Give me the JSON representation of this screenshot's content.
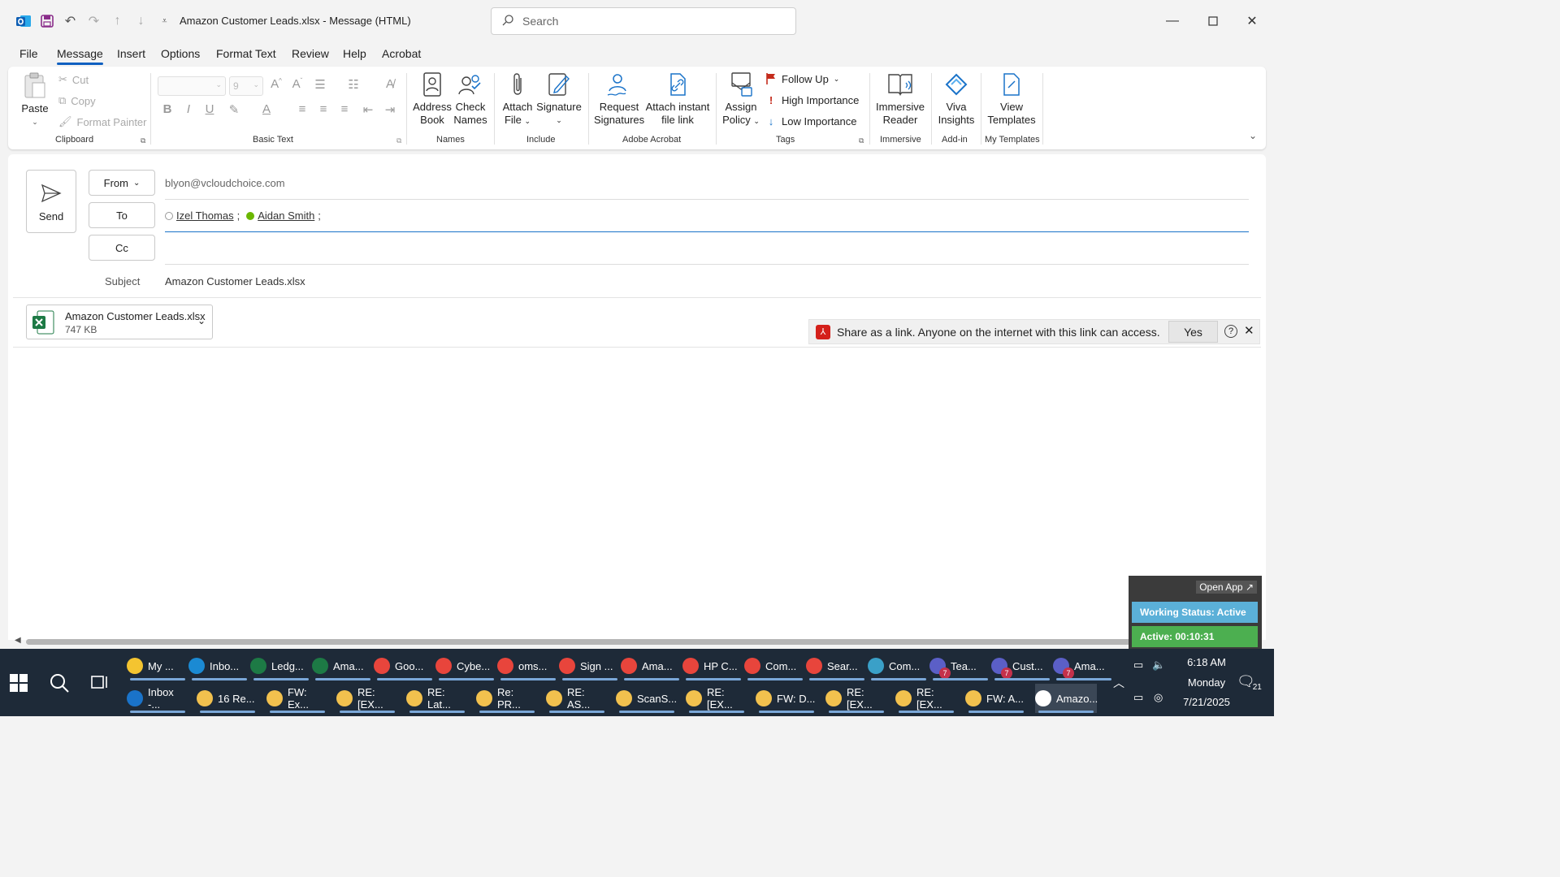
{
  "titlebar": {
    "title": "Amazon Customer Leads.xlsx  -  Message (HTML)",
    "search_placeholder": "Search"
  },
  "menu": {
    "tabs": [
      "File",
      "Message",
      "Insert",
      "Options",
      "Format Text",
      "Review",
      "Help",
      "Acrobat"
    ],
    "active": "Message"
  },
  "ribbon": {
    "clipboard": {
      "label": "Clipboard",
      "paste": "Paste",
      "cut": "Cut",
      "copy": "Copy",
      "format_painter": "Format Painter"
    },
    "basic_text": {
      "label": "Basic Text",
      "font_size": "9"
    },
    "names": {
      "label": "Names",
      "address_book": [
        "Address",
        "Book"
      ],
      "check_names": [
        "Check",
        "Names"
      ]
    },
    "include": {
      "label": "Include",
      "attach_file": [
        "Attach",
        "File"
      ],
      "signature": "Signature"
    },
    "adobe": {
      "label": "Adobe Acrobat",
      "request_signatures": [
        "Request",
        "Signatures"
      ],
      "attach_instant": [
        "Attach instant",
        "file link"
      ]
    },
    "tags": {
      "label": "Tags",
      "assign_policy": [
        "Assign",
        "Policy"
      ],
      "follow_up": "Follow Up",
      "high": "High Importance",
      "low": "Low Importance"
    },
    "immersive": {
      "label": "Immersive",
      "reader": [
        "Immersive",
        "Reader"
      ]
    },
    "addin": {
      "label": "Add-in",
      "viva": [
        "Viva",
        "Insights"
      ]
    },
    "templates": {
      "label": "My Templates",
      "view": [
        "View",
        "Templates"
      ]
    }
  },
  "compose": {
    "send": "Send",
    "from_label": "From",
    "from_value": "blyon@vcloudchoice.com",
    "to_label": "To",
    "recipients": [
      "Izel Thomas",
      "Aidan Smith"
    ],
    "cc_label": "Cc",
    "subject_label": "Subject",
    "subject_value": "Amazon Customer Leads.xlsx",
    "attachment": {
      "name": "Amazon Customer Leads.xlsx",
      "size": "747 KB"
    },
    "infobar": {
      "text": "Share as a link. Anyone on the internet with this link can access.",
      "yes": "Yes"
    }
  },
  "widget": {
    "open_app": "Open App",
    "status": "Working Status: Active",
    "active": "Active: 00:10:31"
  },
  "taskbar": {
    "row1": [
      {
        "label": "My ...",
        "icon": "folder-icon",
        "color": "#f4c430"
      },
      {
        "label": "Inbo...",
        "icon": "edge-icon",
        "color": "#1b8ad3"
      },
      {
        "label": "Ledg...",
        "icon": "excel-icon",
        "color": "#1d7a45"
      },
      {
        "label": "Ama...",
        "icon": "excel-icon",
        "color": "#1d7a45"
      },
      {
        "label": "Goo...",
        "icon": "chrome-icon",
        "color": "#e8453c"
      },
      {
        "label": "Cybe...",
        "icon": "chrome-icon",
        "color": "#e8453c"
      },
      {
        "label": "oms...",
        "icon": "chrome-icon",
        "color": "#e8453c"
      },
      {
        "label": "Sign ...",
        "icon": "chrome-icon",
        "color": "#e8453c"
      },
      {
        "label": "Ama...",
        "icon": "chrome-icon",
        "color": "#e8453c"
      },
      {
        "label": "HP C...",
        "icon": "chrome-icon",
        "color": "#e8453c"
      },
      {
        "label": "Com...",
        "icon": "chrome-icon",
        "color": "#e8453c"
      },
      {
        "label": "Sear...",
        "icon": "chrome-icon",
        "color": "#e8453c"
      },
      {
        "label": "Com...",
        "icon": "app-icon",
        "color": "#3aa0c8"
      },
      {
        "label": "Tea...",
        "icon": "teams-icon",
        "color": "#5b5fc7",
        "badge": "7"
      },
      {
        "label": "Cust...",
        "icon": "teams-icon",
        "color": "#5b5fc7",
        "badge": "7"
      },
      {
        "label": "Ama...",
        "icon": "teams-icon",
        "color": "#5b5fc7",
        "badge": "7"
      }
    ],
    "row2": [
      {
        "label": "Inbox -...",
        "icon": "outlook-icon",
        "color": "#1a73c9"
      },
      {
        "label": "16 Re...",
        "icon": "bell-icon",
        "color": "#f2c14e"
      },
      {
        "label": "FW: Ex...",
        "icon": "mail-icon",
        "color": "#f2c14e"
      },
      {
        "label": "RE: [EX...",
        "icon": "mail-icon",
        "color": "#f2c14e"
      },
      {
        "label": "RE: Lat...",
        "icon": "mail-icon",
        "color": "#f2c14e"
      },
      {
        "label": "Re: PR...",
        "icon": "mail-icon",
        "color": "#f2c14e"
      },
      {
        "label": "RE: AS...",
        "icon": "mail-icon",
        "color": "#f2c14e"
      },
      {
        "label": "ScanS...",
        "icon": "mail-icon",
        "color": "#f2c14e"
      },
      {
        "label": "RE: [EX...",
        "icon": "mail-icon",
        "color": "#f2c14e"
      },
      {
        "label": "FW: D...",
        "icon": "mail-icon",
        "color": "#f2c14e"
      },
      {
        "label": "RE: [EX...",
        "icon": "mail-icon",
        "color": "#f2c14e"
      },
      {
        "label": "RE: [EX...",
        "icon": "mail-icon",
        "color": "#f2c14e"
      },
      {
        "label": "FW: A...",
        "icon": "mail-icon",
        "color": "#f2c14e"
      },
      {
        "label": "Amazo...",
        "icon": "compose-icon",
        "color": "#ffffff",
        "active": true
      }
    ],
    "clock": {
      "time": "6:18 AM",
      "day": "Monday",
      "date": "7/21/2025"
    },
    "notifications": "21"
  }
}
